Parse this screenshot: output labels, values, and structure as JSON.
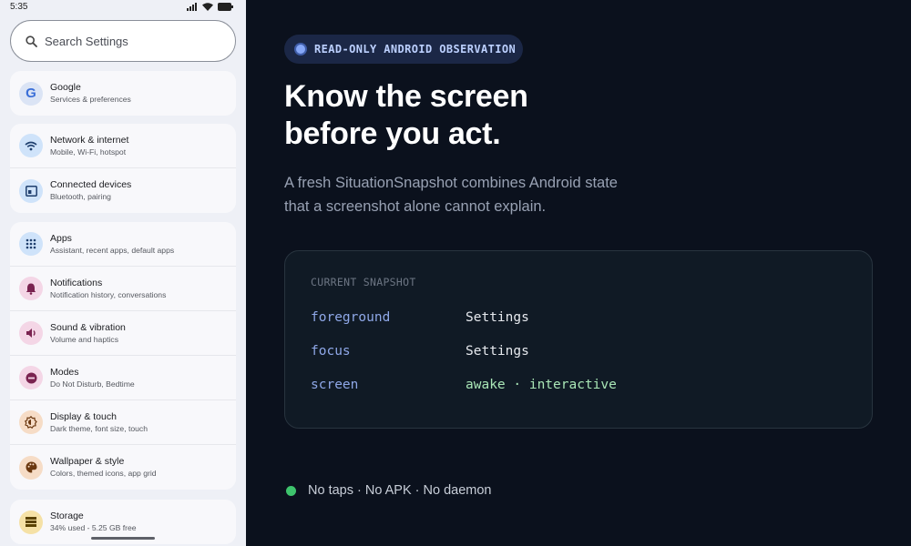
{
  "statusbar": {
    "time": "5:35"
  },
  "search": {
    "placeholder": "Search Settings"
  },
  "settings_groups": [
    [
      {
        "title": "Google",
        "subtitle": "Services & preferences",
        "icon": "google-icon"
      }
    ],
    [
      {
        "title": "Network & internet",
        "subtitle": "Mobile, Wi-Fi, hotspot",
        "icon": "wifi-icon"
      },
      {
        "title": "Connected devices",
        "subtitle": "Bluetooth, pairing",
        "icon": "devices-icon"
      }
    ],
    [
      {
        "title": "Apps",
        "subtitle": "Assistant, recent apps, default apps",
        "icon": "apps-grid-icon"
      },
      {
        "title": "Notifications",
        "subtitle": "Notification history, conversations",
        "icon": "bell-icon"
      },
      {
        "title": "Sound & vibration",
        "subtitle": "Volume and haptics",
        "icon": "speaker-icon"
      },
      {
        "title": "Modes",
        "subtitle": "Do Not Disturb, Bedtime",
        "icon": "do-not-disturb-icon"
      },
      {
        "title": "Display & touch",
        "subtitle": "Dark theme, font size, touch",
        "icon": "brightness-icon"
      },
      {
        "title": "Wallpaper & style",
        "subtitle": "Colors, themed icons, app grid",
        "icon": "palette-icon"
      }
    ],
    [
      {
        "title": "Storage",
        "subtitle": "34% used - 5.25 GB free",
        "icon": "storage-icon"
      }
    ]
  ],
  "hero": {
    "badge": "READ-ONLY ANDROID OBSERVATION",
    "headline_line1": "Know the screen",
    "headline_line2": "before you act.",
    "lead_line1": "A fresh SituationSnapshot combines Android state",
    "lead_line2": "that a screenshot alone cannot explain."
  },
  "snapshot": {
    "label": "CURRENT SNAPSHOT",
    "rows": [
      {
        "key": "foreground",
        "value": "Settings"
      },
      {
        "key": "focus",
        "value": "Settings"
      },
      {
        "key": "screen",
        "value": "awake · interactive"
      }
    ]
  },
  "footer": {
    "text": "No taps · No APK · No daemon"
  },
  "colors": {
    "accent_blue": "#86a7f7",
    "status_green": "#3ec46d",
    "panel_bg": "#0b111d",
    "phone_bg": "#eef0f6"
  }
}
